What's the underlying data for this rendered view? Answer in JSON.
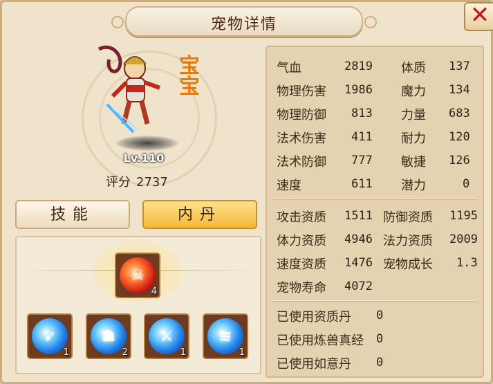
{
  "window": {
    "title": "宠物详情",
    "close_icon": "close-icon"
  },
  "pet": {
    "baby_tag": "宝宝",
    "level_text": "Lv.110",
    "score_label": "评分",
    "score_value": "2737"
  },
  "tabs": [
    {
      "label": "技能",
      "selected": false
    },
    {
      "label": "内丹",
      "selected": true
    }
  ],
  "neidan": {
    "main": {
      "icon": "fire-demon-orb-icon",
      "count": "4"
    },
    "slots": [
      {
        "icon": "blue-claw-orb-icon",
        "count": "1"
      },
      {
        "icon": "blue-beast-orb-icon",
        "count": "2"
      },
      {
        "icon": "blue-shield-orb-icon",
        "count": "1"
      },
      {
        "icon": "blue-slash-orb-icon",
        "count": "1"
      }
    ]
  },
  "attributes": {
    "left": [
      {
        "label": "气血",
        "value": "2819"
      },
      {
        "label": "物理伤害",
        "value": "1986"
      },
      {
        "label": "物理防御",
        "value": "813"
      },
      {
        "label": "法术伤害",
        "value": "411"
      },
      {
        "label": "法术防御",
        "value": "777"
      },
      {
        "label": "速度",
        "value": "611"
      }
    ],
    "right": [
      {
        "label": "体质",
        "value": "137"
      },
      {
        "label": "魔力",
        "value": "134"
      },
      {
        "label": "力量",
        "value": "683"
      },
      {
        "label": "耐力",
        "value": "120"
      },
      {
        "label": "敏捷",
        "value": "126"
      },
      {
        "label": "潜力",
        "value": "0"
      }
    ]
  },
  "aptitudes": [
    {
      "label": "攻击资质",
      "value": "1511"
    },
    {
      "label": "防御资质",
      "value": "1195"
    },
    {
      "label": "体力资质",
      "value": "4946"
    },
    {
      "label": "法力资质",
      "value": "2009"
    },
    {
      "label": "速度资质",
      "value": "1476"
    },
    {
      "label": "宠物成长",
      "value": "1.3"
    },
    {
      "label": "宠物寿命",
      "value": "4072"
    }
  ],
  "usage": [
    {
      "label": "已使用资质丹",
      "value": "0"
    },
    {
      "label": "已使用炼兽真经",
      "value": "0"
    },
    {
      "label": "已使用如意丹",
      "value": "0"
    }
  ],
  "colors": {
    "accent_gold": "#f3b83a",
    "close_red": "#c01a12",
    "panel_bg": "#efe3cb"
  }
}
